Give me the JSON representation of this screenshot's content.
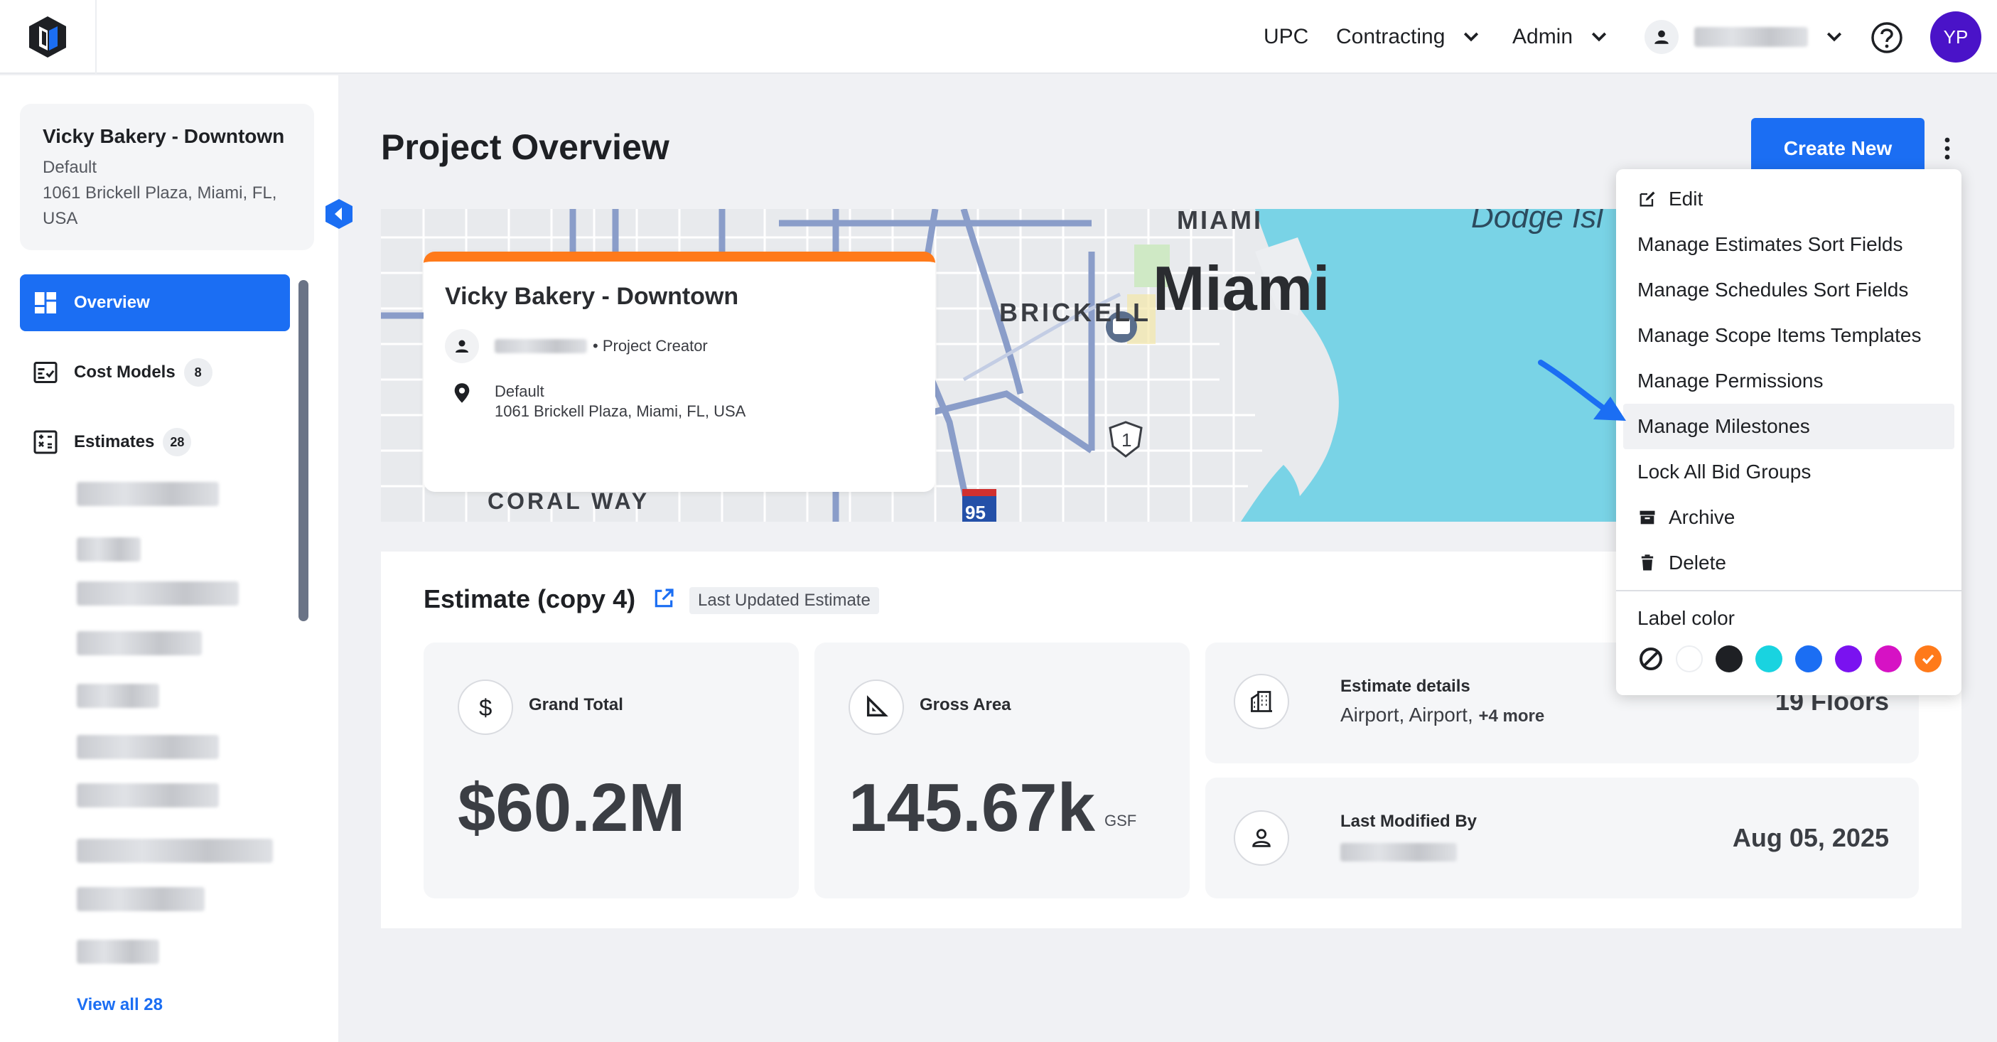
{
  "topbar": {
    "logo": "company-logo",
    "nav": [
      {
        "label": "UPC",
        "has_dropdown": false
      },
      {
        "label": "Contracting",
        "has_dropdown": true
      },
      {
        "label": "Admin",
        "has_dropdown": true
      }
    ],
    "avatar_initials": "YP"
  },
  "sidebar": {
    "project": {
      "name": "Vicky Bakery - Downtown",
      "location_label": "Default",
      "address": "1061 Brickell Plaza, Miami, FL, USA"
    },
    "items": [
      {
        "label": "Overview",
        "icon": "dashboard-icon",
        "active": true
      },
      {
        "label": "Cost Models",
        "icon": "cost-models-icon",
        "count": "8"
      },
      {
        "label": "Estimates",
        "icon": "estimates-icon",
        "count": "28"
      }
    ],
    "view_all": "View all 28"
  },
  "main": {
    "title": "Project Overview",
    "create_button": "Create New",
    "map": {
      "labels": [
        "MIAMI",
        "Miami",
        "BRICKELL",
        "CORAL WAY",
        "Dodge Isl",
        "1",
        "95"
      ],
      "card": {
        "title": "Vicky Bakery - Downtown",
        "creator_role": "• Project Creator",
        "location_label": "Default",
        "address": "1061 Brickell Plaza, Miami, FL, USA"
      }
    },
    "estimate": {
      "title": "Estimate (copy 4)",
      "tag": "Last Updated Estimate",
      "grand_total_label": "Grand Total",
      "grand_total_value": "$60.2M",
      "gross_area_label": "Gross Area",
      "gross_area_value": "145.67k",
      "gross_area_unit": "GSF",
      "details_label": "Estimate details",
      "details_value": "Airport, Airport,",
      "details_more": "+4 more",
      "floors": "19 Floors",
      "last_modified_label": "Last Modified By",
      "last_modified_date": "Aug 05, 2025"
    }
  },
  "menu": {
    "items": [
      {
        "label": "Edit",
        "icon": "edit-icon"
      },
      {
        "label": "Manage Estimates Sort Fields"
      },
      {
        "label": "Manage Schedules Sort Fields"
      },
      {
        "label": "Manage Scope Items Templates"
      },
      {
        "label": "Manage Permissions"
      },
      {
        "label": "Manage Milestones",
        "highlighted": true
      },
      {
        "label": "Lock All Bid Groups"
      },
      {
        "label": "Archive",
        "icon": "archive-icon"
      },
      {
        "label": "Delete",
        "icon": "trash-icon"
      }
    ],
    "label_color": "Label color",
    "swatches": [
      "none",
      "#ffffff",
      "#1e2024",
      "#19d3e0",
      "#1b6ef3",
      "#7a12f0",
      "#d612c4",
      "#ff7a1a"
    ],
    "selected_swatch": "#ff7a1a"
  },
  "colors": {
    "primary": "#1b6ef3",
    "accent_orange": "#ff7a1a",
    "avatar": "#4a13c8"
  }
}
